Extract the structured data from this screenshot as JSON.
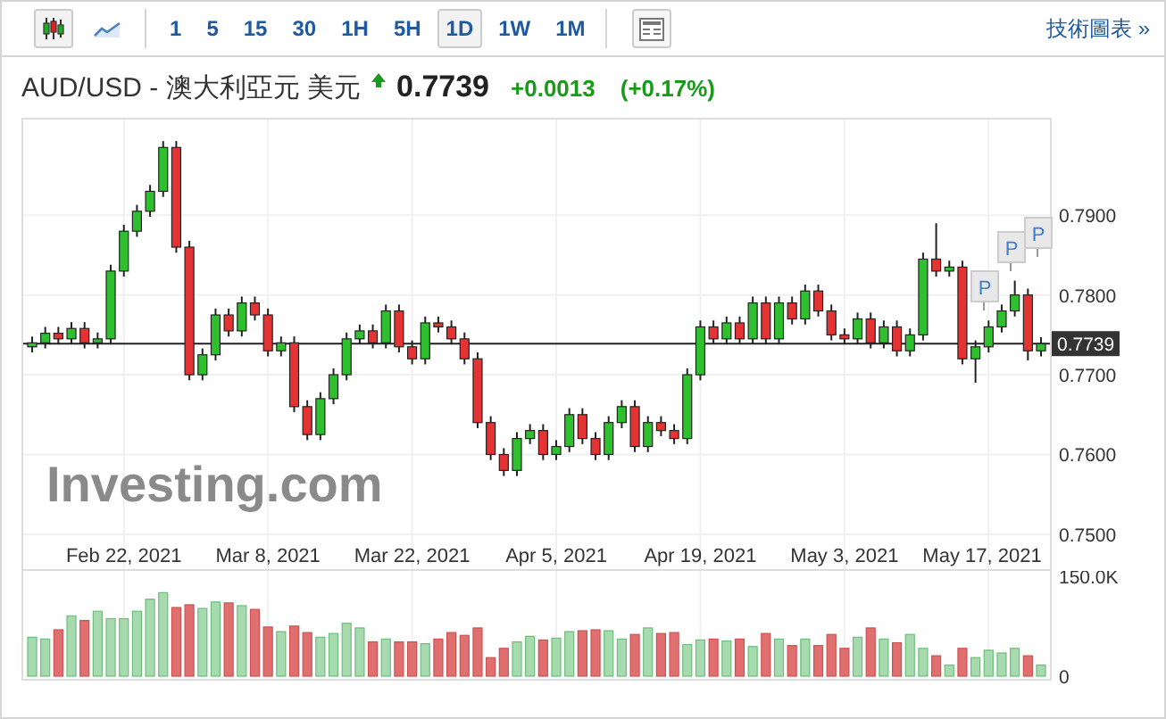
{
  "toolbar": {
    "chart_types": [
      {
        "kind": "candles",
        "selected": true
      },
      {
        "kind": "line",
        "selected": false
      }
    ],
    "intervals": [
      {
        "label": "1",
        "selected": false
      },
      {
        "label": "5",
        "selected": false
      },
      {
        "label": "15",
        "selected": false
      },
      {
        "label": "30",
        "selected": false
      },
      {
        "label": "1H",
        "selected": false
      },
      {
        "label": "5H",
        "selected": false
      },
      {
        "label": "1D",
        "selected": true
      },
      {
        "label": "1W",
        "selected": false
      },
      {
        "label": "1M",
        "selected": false
      }
    ],
    "link": "技術圖表 »"
  },
  "quote": {
    "title": "AUD/USD - 澳大利亞元 美元",
    "rising": true,
    "price": "0.7739",
    "change": "+0.0013",
    "change_percent": "(+0.17%)"
  },
  "chart": {
    "logo": "Investing.com",
    "volume_ticks": [
      "150.0K",
      "0"
    ],
    "markers": [
      "P",
      "P",
      "P"
    ],
    "chart_data": {
      "type": "candlestick",
      "categories": [
        null,
        null,
        null,
        null,
        null,
        null,
        null,
        "Feb 22, 2021",
        null,
        null,
        null,
        null,
        null,
        null,
        null,
        null,
        null,
        null,
        "Mar 8, 2021",
        null,
        null,
        null,
        null,
        null,
        null,
        null,
        null,
        null,
        null,
        "Mar 22, 2021",
        null,
        null,
        null,
        null,
        null,
        null,
        null,
        null,
        null,
        null,
        "Apr 5, 2021",
        null,
        null,
        null,
        null,
        null,
        null,
        null,
        null,
        null,
        null,
        "Apr 19, 2021",
        null,
        null,
        null,
        null,
        null,
        null,
        null,
        null,
        null,
        null,
        "May 3, 2021",
        null,
        null,
        null,
        null,
        null,
        null,
        null,
        null,
        null,
        null,
        "May 17, 2021",
        null,
        null,
        null,
        null
      ],
      "ylim": [
        0.7454,
        0.802
      ],
      "grid": true,
      "ref_lines": [
        {
          "axis": "y",
          "value": 0.7739,
          "label": "0.7739"
        }
      ],
      "ohlc": [
        [
          0.7735,
          0.7748,
          0.7728,
          0.774
        ],
        [
          0.774,
          0.776,
          0.7733,
          0.7752
        ],
        [
          0.7752,
          0.776,
          0.7738,
          0.7745
        ],
        [
          0.7745,
          0.7766,
          0.7738,
          0.7758
        ],
        [
          0.7758,
          0.7766,
          0.7733,
          0.774
        ],
        [
          0.774,
          0.7753,
          0.7733,
          0.7745
        ],
        [
          0.7745,
          0.7838,
          0.7738,
          0.783
        ],
        [
          0.783,
          0.7888,
          0.7823,
          0.788
        ],
        [
          0.788,
          0.7913,
          0.7873,
          0.7905
        ],
        [
          0.7905,
          0.7938,
          0.7898,
          0.793
        ],
        [
          0.793,
          0.7993,
          0.7923,
          0.7985
        ],
        [
          0.7985,
          0.7993,
          0.7853,
          0.786
        ],
        [
          0.786,
          0.7868,
          0.7693,
          0.77
        ],
        [
          0.77,
          0.7733,
          0.7693,
          0.7725
        ],
        [
          0.7725,
          0.7783,
          0.7718,
          0.7775
        ],
        [
          0.7775,
          0.7783,
          0.7748,
          0.7755
        ],
        [
          0.7755,
          0.7798,
          0.7748,
          0.779
        ],
        [
          0.779,
          0.7798,
          0.7768,
          0.7775
        ],
        [
          0.7775,
          0.7783,
          0.7723,
          0.773
        ],
        [
          0.773,
          0.7748,
          0.7723,
          0.774
        ],
        [
          0.774,
          0.7748,
          0.7653,
          0.766
        ],
        [
          0.766,
          0.7668,
          0.7618,
          0.7625
        ],
        [
          0.7625,
          0.7678,
          0.7618,
          0.767
        ],
        [
          0.767,
          0.7708,
          0.7663,
          0.77
        ],
        [
          0.77,
          0.7753,
          0.7693,
          0.7745
        ],
        [
          0.7745,
          0.7763,
          0.7738,
          0.7755
        ],
        [
          0.7755,
          0.7763,
          0.7733,
          0.774
        ],
        [
          0.774,
          0.7788,
          0.7733,
          0.778
        ],
        [
          0.778,
          0.7788,
          0.7728,
          0.7735
        ],
        [
          0.7735,
          0.7743,
          0.7713,
          0.772
        ],
        [
          0.772,
          0.7773,
          0.7713,
          0.7765
        ],
        [
          0.7765,
          0.7773,
          0.7753,
          0.776
        ],
        [
          0.776,
          0.7768,
          0.7738,
          0.7745
        ],
        [
          0.7745,
          0.7753,
          0.7713,
          0.772
        ],
        [
          0.772,
          0.7728,
          0.7633,
          0.764
        ],
        [
          0.764,
          0.7648,
          0.7593,
          0.76
        ],
        [
          0.76,
          0.7608,
          0.7573,
          0.758
        ],
        [
          0.758,
          0.7628,
          0.7573,
          0.762
        ],
        [
          0.762,
          0.7638,
          0.7613,
          0.763
        ],
        [
          0.763,
          0.7638,
          0.7593,
          0.76
        ],
        [
          0.76,
          0.7618,
          0.7593,
          0.761
        ],
        [
          0.761,
          0.7658,
          0.7603,
          0.765
        ],
        [
          0.765,
          0.7658,
          0.7613,
          0.762
        ],
        [
          0.762,
          0.7628,
          0.7593,
          0.76
        ],
        [
          0.76,
          0.7648,
          0.7593,
          0.764
        ],
        [
          0.764,
          0.7668,
          0.7633,
          0.766
        ],
        [
          0.766,
          0.7668,
          0.7603,
          0.761
        ],
        [
          0.761,
          0.7648,
          0.7603,
          0.764
        ],
        [
          0.764,
          0.7648,
          0.7623,
          0.763
        ],
        [
          0.763,
          0.7638,
          0.7613,
          0.762
        ],
        [
          0.762,
          0.7708,
          0.7613,
          0.77
        ],
        [
          0.77,
          0.7768,
          0.7693,
          0.776
        ],
        [
          0.776,
          0.7768,
          0.7738,
          0.7745
        ],
        [
          0.7745,
          0.7773,
          0.7738,
          0.7765
        ],
        [
          0.7765,
          0.7773,
          0.7738,
          0.7745
        ],
        [
          0.7745,
          0.7798,
          0.7738,
          0.779
        ],
        [
          0.779,
          0.7798,
          0.7738,
          0.7745
        ],
        [
          0.7745,
          0.7798,
          0.7738,
          0.779
        ],
        [
          0.779,
          0.7798,
          0.7763,
          0.777
        ],
        [
          0.777,
          0.7813,
          0.7763,
          0.7805
        ],
        [
          0.7805,
          0.7813,
          0.7773,
          0.778
        ],
        [
          0.778,
          0.7788,
          0.7743,
          0.775
        ],
        [
          0.775,
          0.7758,
          0.7738,
          0.7745
        ],
        [
          0.7745,
          0.7778,
          0.7738,
          0.777
        ],
        [
          0.777,
          0.7778,
          0.7733,
          0.774
        ],
        [
          0.774,
          0.7768,
          0.7733,
          0.776
        ],
        [
          0.776,
          0.7768,
          0.7723,
          0.773
        ],
        [
          0.773,
          0.7758,
          0.7723,
          0.775
        ],
        [
          0.775,
          0.7853,
          0.7743,
          0.7845
        ],
        [
          0.7845,
          0.789,
          0.7823,
          0.783
        ],
        [
          0.783,
          0.7843,
          0.7823,
          0.7835
        ],
        [
          0.7835,
          0.7843,
          0.7713,
          0.772
        ],
        [
          0.772,
          0.7743,
          0.769,
          0.7735
        ],
        [
          0.7735,
          0.7768,
          0.7728,
          0.776
        ],
        [
          0.776,
          0.7788,
          0.7753,
          0.778
        ],
        [
          0.778,
          0.7818,
          0.7773,
          0.78
        ],
        [
          0.78,
          0.7808,
          0.7718,
          0.773
        ],
        [
          0.773,
          0.7747,
          0.7723,
          0.7739
        ]
      ],
      "yticks": [
        {
          "value": 0.79,
          "label": "0.7900"
        },
        {
          "value": 0.78,
          "label": "0.7800"
        },
        {
          "value": 0.77,
          "label": "0.7700"
        },
        {
          "value": 0.76,
          "label": "0.7600"
        },
        {
          "value": 0.75,
          "label": "0.7500"
        }
      ]
    }
  }
}
